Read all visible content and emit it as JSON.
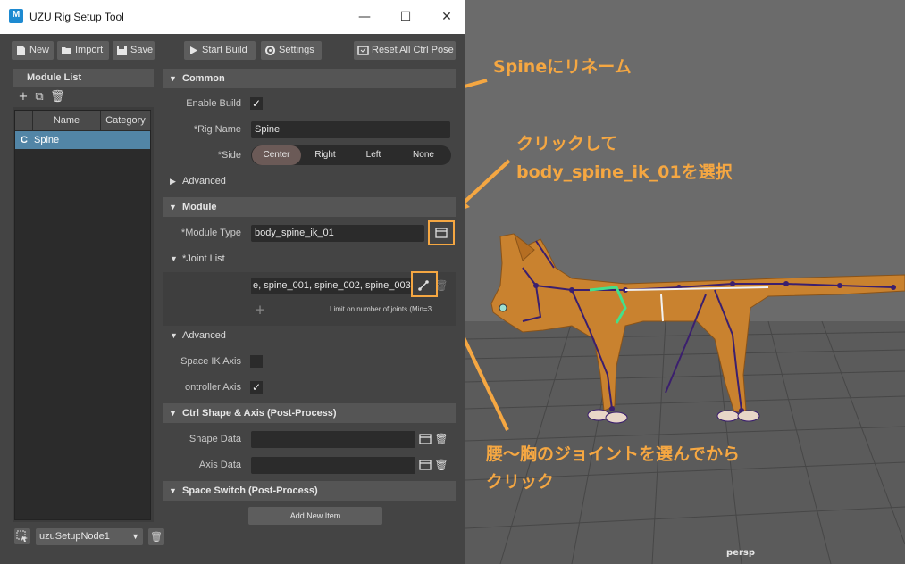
{
  "window": {
    "title": "UZU Rig Setup Tool",
    "app_icon": "M",
    "minimize_glyph": "—",
    "maximize_glyph": "☐",
    "close_glyph": "✕"
  },
  "toolbar": {
    "new_label": "New",
    "import_label": "Import",
    "save_label": "Save",
    "start_build_label": "Start Build",
    "settings_label": "Settings",
    "reset_label": "Reset All Ctrl Pose"
  },
  "module_list": {
    "header": "Module List",
    "columns": [
      "Name",
      "Category"
    ],
    "rows": [
      {
        "type": "C",
        "name": "Spine",
        "category": ""
      }
    ],
    "node_select": "uzuSetupNode1"
  },
  "common": {
    "header": "Common",
    "enable_build_label": "Enable Build",
    "enable_build_checked": true,
    "rig_name_label": "*Rig Name",
    "rig_name_value": "Spine",
    "side_label": "*Side",
    "side_options": [
      "Center",
      "Right",
      "Left",
      "None"
    ],
    "side_selected": "Center",
    "advanced_label": "Advanced"
  },
  "module": {
    "header": "Module",
    "module_type_label": "*Module Type",
    "module_type_value": "body_spine_ik_01"
  },
  "joint_list": {
    "header": "*Joint List",
    "value": "e, spine_001, spine_002, spine_003",
    "limit_text": "Limit on number of joints (Min=3"
  },
  "advanced2": {
    "header": "Advanced",
    "space_ik_axis_label": "Space IK Axis",
    "space_ik_axis_checked": false,
    "controller_axis_label": "ontroller Axis",
    "controller_axis_checked": true
  },
  "ctrl_shape": {
    "header": "Ctrl Shape & Axis (Post-Process)",
    "shape_data_label": "Shape Data",
    "shape_data_value": "",
    "axis_data_label": "Axis Data",
    "axis_data_value": ""
  },
  "space_switch": {
    "header": "Space Switch (Post-Process)",
    "add_item_label": "Add New Item"
  },
  "viewport": {
    "camera_label": "persp"
  },
  "annotations": {
    "rename": "Spineにリネーム",
    "click_select_1": "クリックして",
    "click_select_2": "body_spine_ik_01を選択",
    "joints_1": "腰〜胸のジョイントを選んでから",
    "joints_2": "クリック",
    "color": "#f5a742"
  },
  "colors": {
    "panel_bg": "#444444",
    "section_header": "#555555",
    "field_bg": "#2b2b2b",
    "selection": "#5285a6",
    "side_selected": "#6b5a57",
    "cat_body": "#c9822f",
    "joint": "#3b1f6e"
  }
}
